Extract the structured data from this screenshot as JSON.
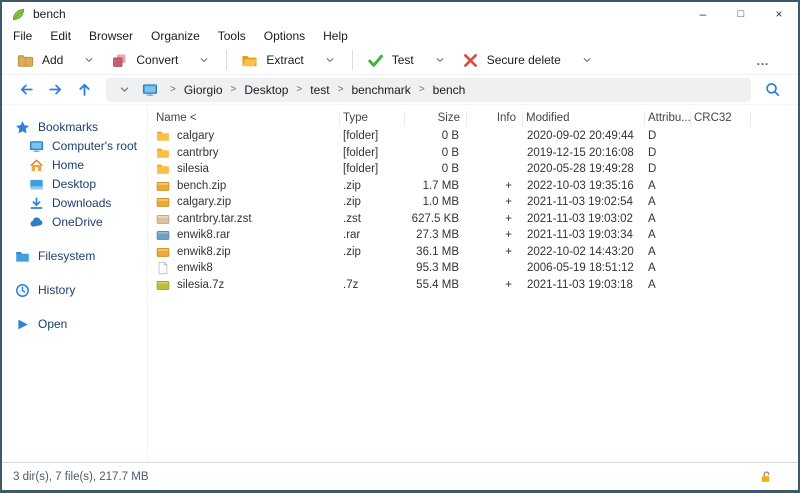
{
  "window": {
    "title": "bench"
  },
  "titlebar_icons": {
    "minimize": "–",
    "maximize": "□",
    "close": "×"
  },
  "menu": {
    "items": [
      "File",
      "Edit",
      "Browser",
      "Organize",
      "Tools",
      "Options",
      "Help"
    ]
  },
  "toolbar": {
    "more_label": "…",
    "buttons": [
      {
        "label": "Add",
        "icon": "add-archive",
        "divider_after": false
      },
      {
        "label": "Convert",
        "icon": "convert",
        "divider_after": true
      },
      {
        "label": "Extract",
        "icon": "extract",
        "divider_after": true
      },
      {
        "label": "Test",
        "icon": "test",
        "divider_after": false
      },
      {
        "label": "Secure delete",
        "icon": "secure-delete",
        "divider_after": false
      }
    ]
  },
  "addressbar": {
    "separator": ">",
    "crumbs": [
      "Giorgio",
      "Desktop",
      "test",
      "benchmark",
      "bench"
    ]
  },
  "sidebar": {
    "items": [
      {
        "label": "Bookmarks",
        "icon": "star",
        "indent": 0,
        "gap": false
      },
      {
        "label": "Computer's root",
        "icon": "monitor",
        "indent": 1,
        "gap": false
      },
      {
        "label": "Home",
        "icon": "home",
        "indent": 1,
        "gap": false
      },
      {
        "label": "Desktop",
        "icon": "desktop",
        "indent": 1,
        "gap": false
      },
      {
        "label": "Downloads",
        "icon": "download",
        "indent": 1,
        "gap": false
      },
      {
        "label": "OneDrive",
        "icon": "cloud",
        "indent": 1,
        "gap": false
      },
      {
        "label": "Filesystem",
        "icon": "folder-blue",
        "indent": 0,
        "gap": true
      },
      {
        "label": "History",
        "icon": "clock",
        "indent": 0,
        "gap": true
      },
      {
        "label": "Open",
        "icon": "play",
        "indent": 0,
        "gap": true
      }
    ]
  },
  "filelist": {
    "columns": [
      "Name <",
      "Type",
      "Size",
      "Info",
      "Modified",
      "Attribu...",
      "CRC32"
    ],
    "rows": [
      {
        "icon": "folder",
        "name": "calgary",
        "type": "[folder]",
        "size": "0 B",
        "info": "",
        "modified": "2020-09-02 20:49:44",
        "attr": "D",
        "crc": ""
      },
      {
        "icon": "folder",
        "name": "cantrbry",
        "type": "[folder]",
        "size": "0 B",
        "info": "",
        "modified": "2019-12-15 20:16:08",
        "attr": "D",
        "crc": ""
      },
      {
        "icon": "folder",
        "name": "silesia",
        "type": "[folder]",
        "size": "0 B",
        "info": "",
        "modified": "2020-05-28 19:49:28",
        "attr": "D",
        "crc": ""
      },
      {
        "icon": "zip",
        "name": "bench.zip",
        "type": ".zip",
        "size": "1.7 MB",
        "info": "+",
        "modified": "2022-10-03 19:35:16",
        "attr": "A",
        "crc": ""
      },
      {
        "icon": "zip",
        "name": "calgary.zip",
        "type": ".zip",
        "size": "1.0 MB",
        "info": "+",
        "modified": "2021-11-03 19:02:54",
        "attr": "A",
        "crc": ""
      },
      {
        "icon": "zst",
        "name": "cantrbry.tar.zst",
        "type": ".zst",
        "size": "627.5 KB",
        "info": "+",
        "modified": "2021-11-03 19:03:02",
        "attr": "A",
        "crc": ""
      },
      {
        "icon": "rar",
        "name": "enwik8.rar",
        "type": ".rar",
        "size": "27.3 MB",
        "info": "+",
        "modified": "2021-11-03 19:03:34",
        "attr": "A",
        "crc": ""
      },
      {
        "icon": "zip",
        "name": "enwik8.zip",
        "type": ".zip",
        "size": "36.1 MB",
        "info": "+",
        "modified": "2022-10-02 14:43:20",
        "attr": "A",
        "crc": ""
      },
      {
        "icon": "file",
        "name": "enwik8",
        "type": "",
        "size": "95.3 MB",
        "info": "",
        "modified": "2006-05-19 18:51:12",
        "attr": "A",
        "crc": ""
      },
      {
        "icon": "7z",
        "name": "silesia.7z",
        "type": ".7z",
        "size": "55.4 MB",
        "info": "+",
        "modified": "2021-11-03 19:03:18",
        "attr": "A",
        "crc": ""
      }
    ]
  },
  "statusbar": {
    "text": "3 dir(s), 7 file(s), 217.7 MB"
  },
  "colors": {
    "accent_blue": "#2f80d8",
    "folder_yellow": "#fcbe45",
    "archive_amber": "#eaa93a",
    "check_green": "#3db53a",
    "delete_red": "#e0493c",
    "lock_yellow": "#eab417",
    "sidebar_text": "#1c3f6e",
    "window_border": "#3b5b6d"
  }
}
